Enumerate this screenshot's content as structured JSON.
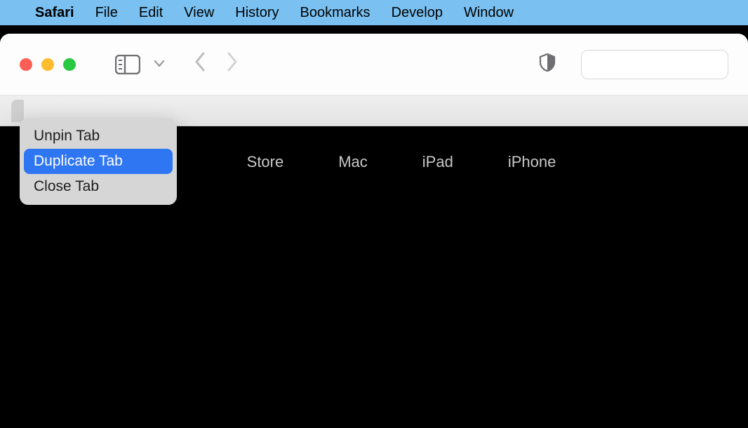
{
  "menubar": {
    "app_name": "Safari",
    "items": [
      "File",
      "Edit",
      "View",
      "History",
      "Bookmarks",
      "Develop",
      "Window"
    ]
  },
  "context_menu": {
    "items": [
      {
        "label": "Unpin Tab",
        "highlighted": false
      },
      {
        "label": "Duplicate Tab",
        "highlighted": true
      },
      {
        "label": "Close Tab",
        "highlighted": false
      }
    ]
  },
  "apple_nav": {
    "items": [
      "Store",
      "Mac",
      "iPad",
      "iPhone"
    ]
  }
}
